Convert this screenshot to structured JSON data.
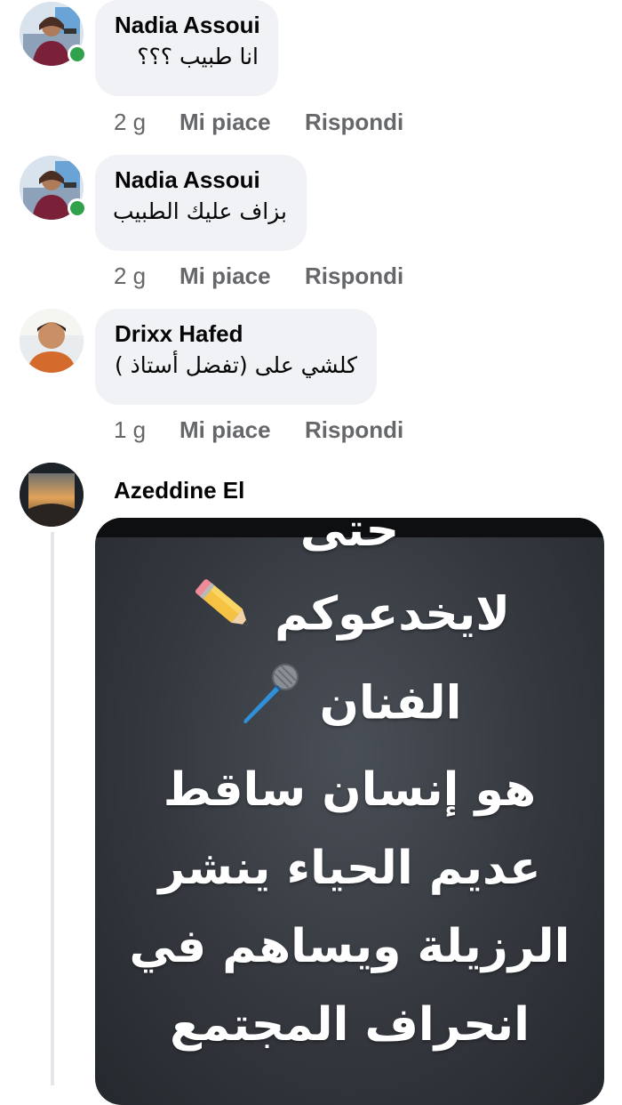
{
  "comments": [
    {
      "author": "Nadia Assoui",
      "text": "انا طبيب ؟؟؟",
      "time": "2 g",
      "like_label": "Mi piace",
      "reply_label": "Rispondi",
      "online": true
    },
    {
      "author": "Nadia Assoui",
      "text": "بزاف عليك الطبيب",
      "time": "2 g",
      "like_label": "Mi piace",
      "reply_label": "Rispondi",
      "online": true
    },
    {
      "author": "Drixx Hafed",
      "text": "كلشي  على  (تفضل أستاذ )",
      "time": "1 g",
      "like_label": "Mi piace",
      "reply_label": "Rispondi",
      "online": false
    }
  ],
  "image_comment": {
    "author": "Azeddine El",
    "image_lines": [
      "حتى",
      "لايخدعوكم",
      "الفنان",
      "هو إنسان ساقط",
      "عديم الحياء ينشر",
      "الرزيلة ويساهم في",
      "انحراف المجتمع"
    ],
    "icons": [
      "pencil-icon",
      "microphone-icon"
    ]
  },
  "colors": {
    "bubble": "#f0f2f5",
    "meta_text": "#65676b",
    "online": "#31a24c",
    "thread_line": "#e4e6eb"
  }
}
